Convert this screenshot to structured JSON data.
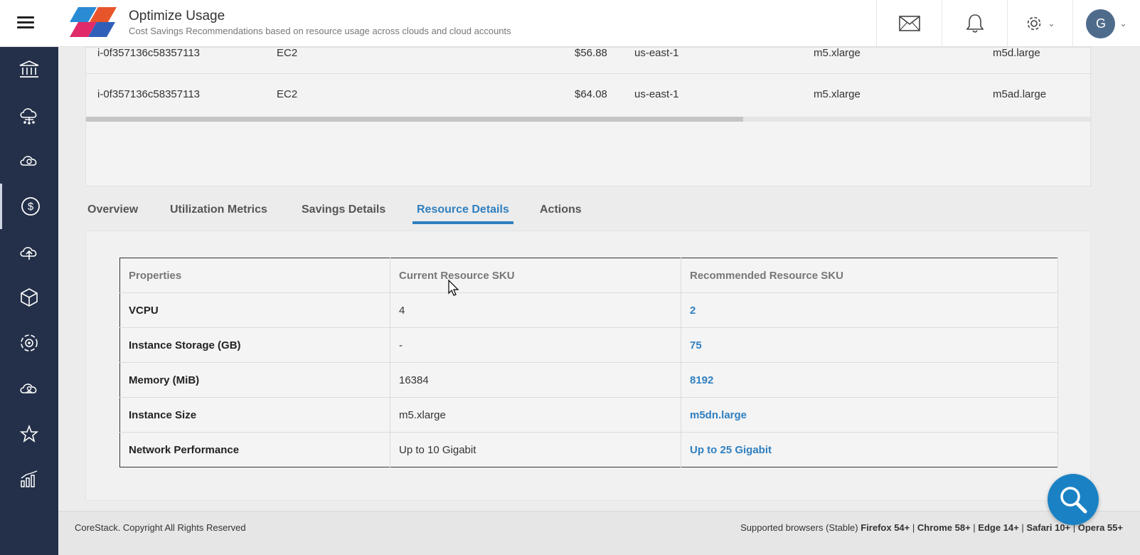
{
  "header": {
    "title": "Optimize Usage",
    "subtitle": "Cost Savings Recommendations based on resource usage across clouds and cloud accounts",
    "user_initial": "G"
  },
  "sidebar": {
    "items": [
      {
        "icon": "bank-icon"
      },
      {
        "icon": "cloud-network-icon"
      },
      {
        "icon": "cloud-icon"
      },
      {
        "icon": "dollar-icon",
        "active": true
      },
      {
        "icon": "cloud-upload-icon"
      },
      {
        "icon": "cube-icon"
      },
      {
        "icon": "settings-cycle-icon"
      },
      {
        "icon": "cloud-person-icon"
      },
      {
        "icon": "star-icon"
      },
      {
        "icon": "bar-chart-icon"
      }
    ]
  },
  "instances": {
    "rows": [
      {
        "id": "i-0f357136c58357113",
        "service": "EC2",
        "cost": "$56.88",
        "region": "us-east-1",
        "current": "m5.xlarge",
        "recommended": "m5d.large"
      },
      {
        "id": "i-0f357136c58357113",
        "service": "EC2",
        "cost": "$64.08",
        "region": "us-east-1",
        "current": "m5.xlarge",
        "recommended": "m5ad.large"
      }
    ]
  },
  "tabs": [
    {
      "label": "Overview"
    },
    {
      "label": "Utilization Metrics"
    },
    {
      "label": "Savings Details"
    },
    {
      "label": "Resource Details",
      "active": true
    },
    {
      "label": "Actions"
    }
  ],
  "details": {
    "headers": [
      "Properties",
      "Current Resource SKU",
      "Recommended Resource SKU"
    ],
    "rows": [
      {
        "property": "VCPU",
        "current": "4",
        "recommended": "2"
      },
      {
        "property": "Instance Storage (GB)",
        "current": "-",
        "recommended": "75"
      },
      {
        "property": "Memory (MiB)",
        "current": "16384",
        "recommended": "8192"
      },
      {
        "property": "Instance Size",
        "current": "m5.xlarge",
        "recommended": "m5dn.large"
      },
      {
        "property": "Network Performance",
        "current": "Up to 10 Gigabit",
        "recommended": "Up to 25 Gigabit"
      }
    ]
  },
  "footer": {
    "copyright": "CoreStack. Copyright All Rights Reserved",
    "browsers_prefix": "Supported browsers (Stable)",
    "browsers": [
      "Firefox 54+",
      "Chrome 58+",
      "Edge 14+",
      "Safari 10+",
      "Opera 55+"
    ]
  },
  "colors": {
    "accent": "#2f7fbf",
    "sidebar_bg": "#243049",
    "fab": "#1a82c4"
  }
}
